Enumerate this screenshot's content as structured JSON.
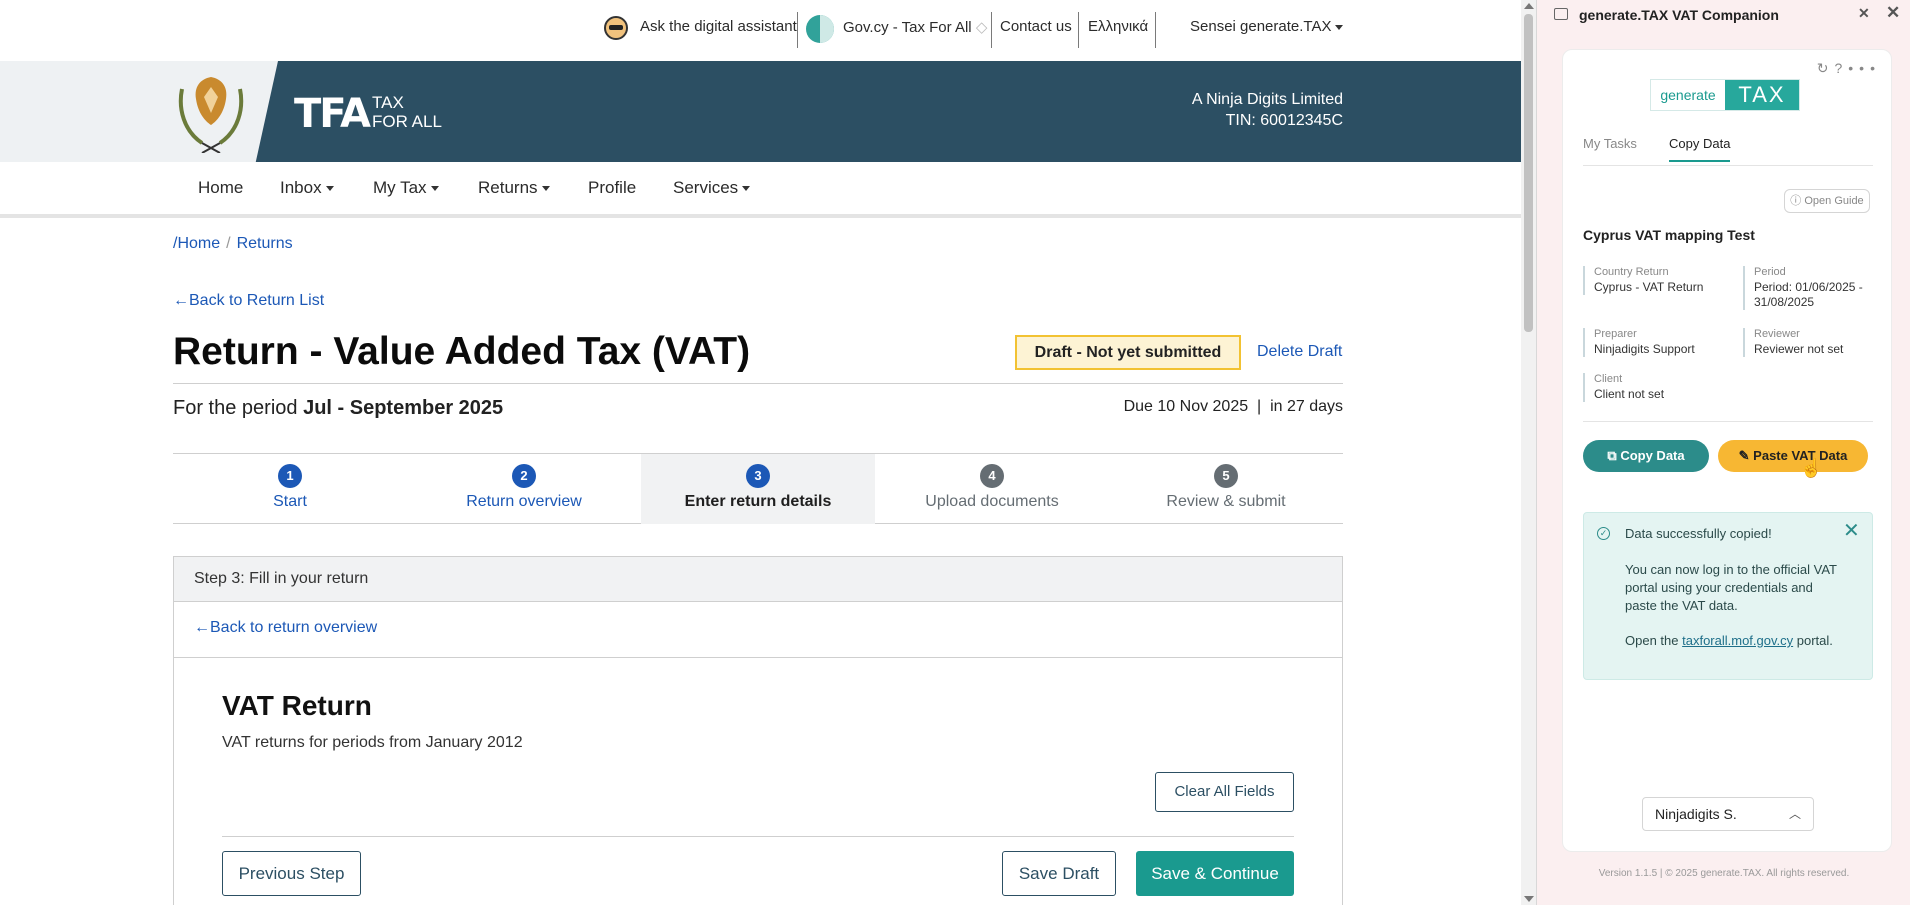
{
  "topbar": {
    "assistant": "Ask the digital assistant",
    "govcy": "Gov.cy - Tax For All",
    "govcy_suffix": "◇",
    "contact": "Contact us",
    "language": "Ελληνικά",
    "user": "Sensei generate.TAX"
  },
  "banner": {
    "logo_mark": "TFA",
    "logo_line1": "TAX",
    "logo_line2": "FOR ALL",
    "company": "A Ninja Digits Limited",
    "tin": "TIN: 60012345C"
  },
  "nav": {
    "home": "Home",
    "inbox": "Inbox",
    "my_tax": "My Tax",
    "returns": "Returns",
    "profile": "Profile",
    "services": "Services"
  },
  "breadcrumb": {
    "prefix": "/",
    "home": "Home",
    "sep": "/",
    "returns": "Returns"
  },
  "back_to_list": "←Back to Return List",
  "title": "Return - Value Added Tax (VAT)",
  "draft_badge": "Draft  - Not yet submitted",
  "delete_draft": "Delete Draft",
  "period": {
    "prefix": "For the period ",
    "value": "Jul - September 2025"
  },
  "due": {
    "date": "Due 10 Nov 2025",
    "sep": "|",
    "days": "in 27 days"
  },
  "steps": [
    {
      "num": "1",
      "label": "Start",
      "state": "done"
    },
    {
      "num": "2",
      "label": "Return overview",
      "state": "done"
    },
    {
      "num": "3",
      "label": "Enter return details",
      "state": "active"
    },
    {
      "num": "4",
      "label": "Upload documents",
      "state": "todo"
    },
    {
      "num": "5",
      "label": "Review & submit",
      "state": "todo"
    }
  ],
  "panel": {
    "header": "Step 3: Fill in your return",
    "back": "←Back to return overview",
    "vat_title": "VAT Return",
    "vat_sub": "VAT returns for periods from January 2012",
    "clear": "Clear All Fields",
    "previous": "Previous Step",
    "save_draft": "Save Draft",
    "save_continue": "Save & Continue"
  },
  "side": {
    "window_title": "generate.TAX VAT Companion",
    "logo_left": "generate",
    "logo_right": "TAX",
    "tabs": [
      "My Tasks",
      "Copy Data"
    ],
    "open_guide": "Open Guide",
    "mapping_title": "Cyprus VAT mapping Test",
    "meta": {
      "country_return_k": "Country Return",
      "country_return_v": "Cyprus - VAT Return",
      "period_k": "Period",
      "period_v": "Period: 01/06/2025 - 31/08/2025",
      "preparer_k": "Preparer",
      "preparer_v": "Ninjadigits Support",
      "reviewer_k": "Reviewer",
      "reviewer_v": "Reviewer not set",
      "client_k": "Client",
      "client_v": "Client not set"
    },
    "copy_btn": "Copy Data",
    "paste_btn": "Paste VAT Data",
    "success_head": "Data successfully copied!",
    "success_body": "You can now log in to the official VAT portal using your credentials and paste the VAT data.",
    "success_open_pre": "Open the ",
    "success_link": "taxforall.mof.gov.cy",
    "success_open_post": " portal.",
    "user": "Ninjadigits S.",
    "version": "Version 1.1.5 | © 2025 generate.TAX. All rights reserved."
  }
}
